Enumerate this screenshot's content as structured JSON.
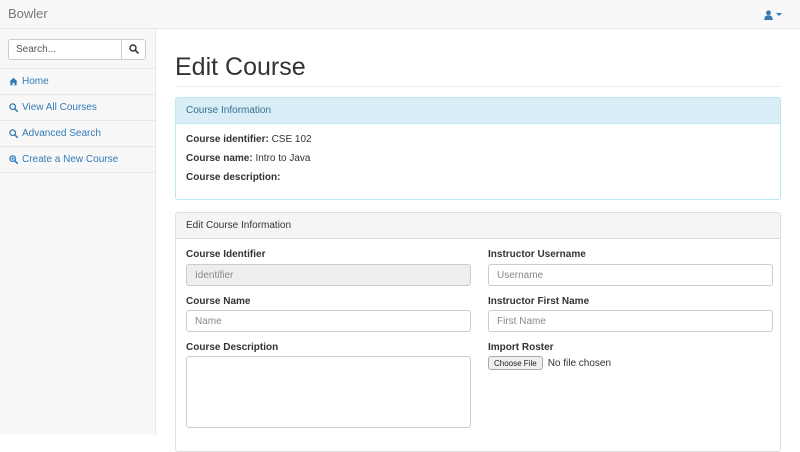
{
  "navbar": {
    "brand": "Bowler",
    "user_icon": "user-icon"
  },
  "sidebar": {
    "search": {
      "placeholder": "Search...",
      "icon": "search-icon"
    },
    "items": [
      {
        "label": "Home",
        "icon": "home-icon"
      },
      {
        "label": "View All Courses",
        "icon": "search-icon"
      },
      {
        "label": "Advanced Search",
        "icon": "search-icon"
      },
      {
        "label": "Create a New Course",
        "icon": "zoom-in-icon"
      }
    ]
  },
  "main": {
    "title": "Edit Course",
    "course_info": {
      "heading": "Course Information",
      "identifier_label": "Course identifier:",
      "identifier_value": "CSE 102",
      "name_label": "Course name:",
      "name_value": "Intro to Java",
      "description_label": "Course description:",
      "description_value": ""
    },
    "edit_form": {
      "heading": "Edit Course Information",
      "course_identifier": {
        "label": "Course Identifier",
        "placeholder": "Identifier",
        "disabled": true
      },
      "course_name": {
        "label": "Course Name",
        "placeholder": "Name"
      },
      "course_description": {
        "label": "Course Description",
        "value": ""
      },
      "instructor_username": {
        "label": "Instructor Username",
        "placeholder": "Username"
      },
      "instructor_first_name": {
        "label": "Instructor First Name",
        "placeholder": "First Name"
      },
      "import_roster": {
        "label": "Import Roster",
        "button_label": "Choose File",
        "status": "No file chosen"
      }
    }
  },
  "colors": {
    "link": "#337ab7",
    "info_heading_bg": "#d9edf7",
    "info_heading_text": "#31708f",
    "navbar_bg": "#f8f8f8"
  }
}
